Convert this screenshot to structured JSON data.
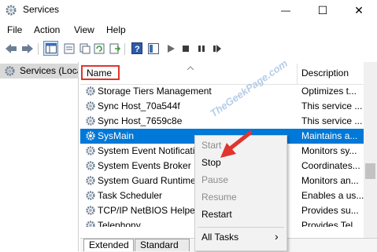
{
  "window": {
    "title": "Services",
    "controls": {
      "minimize": "—",
      "maximize": "☐",
      "close": "✕"
    }
  },
  "menu": {
    "items": [
      "File",
      "Action",
      "View",
      "Help"
    ]
  },
  "toolbar": {
    "icons": [
      "back-arrow-icon",
      "forward-arrow-icon",
      "console-tree-icon",
      "properties-sheet-icon",
      "refresh-icon",
      "export-list-icon",
      "help-icon",
      "view-pane-icon",
      "play-icon",
      "stop-icon",
      "pause-icon",
      "restart-icon"
    ]
  },
  "left_pane": {
    "item_label": "Services (Local)"
  },
  "columns": {
    "name": "Name",
    "description": "Description"
  },
  "rows": [
    {
      "name": "Storage Tiers Management",
      "description": "Optimizes t..."
    },
    {
      "name": "Sync Host_70a544f",
      "description": "This service ..."
    },
    {
      "name": "Sync Host_7659c8e",
      "description": "This service ..."
    },
    {
      "name": "SysMain",
      "description": "Maintains a...",
      "selected": true
    },
    {
      "name": "System Event Notification Service",
      "description": "Monitors sy..."
    },
    {
      "name": "System Events Broker",
      "description": "Coordinates..."
    },
    {
      "name": "System Guard Runtime Monitor Broker",
      "description": "Monitors an..."
    },
    {
      "name": "Task Scheduler",
      "description": "Enables a us..."
    },
    {
      "name": "TCP/IP NetBIOS Helper",
      "description": "Provides su..."
    },
    {
      "name": "Telephony",
      "description": "Provides Tel..."
    }
  ],
  "context_menu": {
    "items": [
      {
        "label": "Start",
        "enabled": false
      },
      {
        "label": "Stop",
        "enabled": true
      },
      {
        "label": "Pause",
        "enabled": false
      },
      {
        "label": "Resume",
        "enabled": false
      },
      {
        "label": "Restart",
        "enabled": true
      },
      {
        "label": "All Tasks",
        "enabled": true,
        "submenu_arrow": "›"
      }
    ]
  },
  "tabs": [
    "Extended",
    "Standard"
  ],
  "watermark": "TheGeekPage.com",
  "colors": {
    "selection": "#0078d7",
    "annotation_red": "#e0342f"
  }
}
